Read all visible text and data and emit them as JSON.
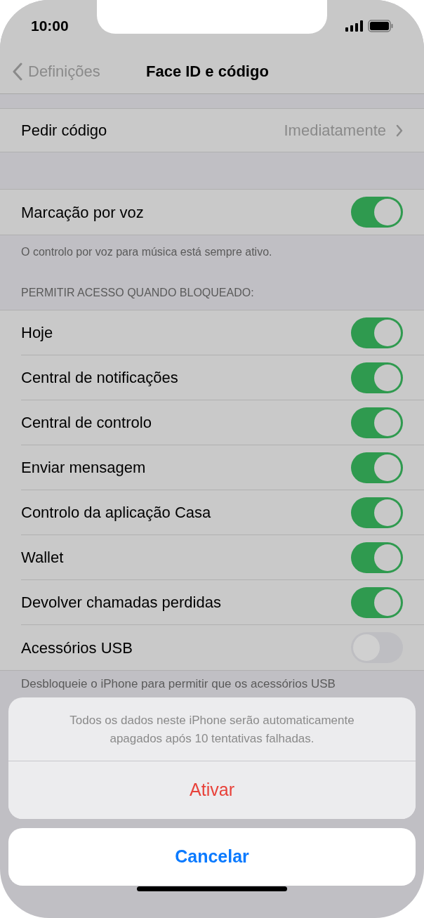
{
  "status_bar": {
    "time": "10:00"
  },
  "nav": {
    "back": "Definições",
    "title": "Face ID e código"
  },
  "passcode_row": {
    "label": "Pedir código",
    "value": "Imediatamente"
  },
  "voice_row": {
    "label": "Marcação por voz",
    "on": true
  },
  "voice_footer": "O controlo por voz para música está sempre ativo.",
  "locked_header": "PERMITIR ACESSO QUANDO BLOQUEADO:",
  "locked_rows": [
    {
      "label": "Hoje",
      "on": true
    },
    {
      "label": "Central de notificações",
      "on": true
    },
    {
      "label": "Central de controlo",
      "on": true
    },
    {
      "label": "Enviar mensagem",
      "on": true
    },
    {
      "label": "Controlo da aplicação Casa",
      "on": true
    },
    {
      "label": "Wallet",
      "on": true
    },
    {
      "label": "Devolver chamadas perdidas",
      "on": true
    },
    {
      "label": "Acessórios USB",
      "on": false
    }
  ],
  "usb_footer": "Desbloqueie o iPhone para permitir que os acessórios USB",
  "action_sheet": {
    "message": "Todos os dados neste iPhone serão automaticamente apagados após 10 tentativas falhadas.",
    "action": "Ativar",
    "cancel": "Cancelar"
  }
}
